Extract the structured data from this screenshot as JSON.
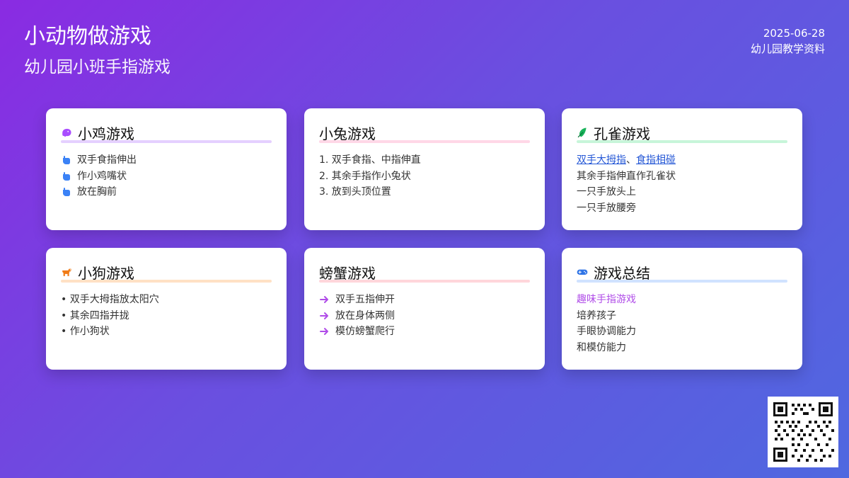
{
  "header": {
    "title": "小动物做游戏",
    "subtitle": "幼儿园小班手指游戏",
    "date": "2025-06-28",
    "source": "幼儿园教学资料"
  },
  "cards": [
    {
      "title": "小鸡游戏",
      "icon": "chick-icon",
      "accent": "#a94dff",
      "underline": "#d7b7ff",
      "items": [
        "双手食指伸出",
        "作小鸡嘴状",
        "放在胸前"
      ]
    },
    {
      "title": "小兔游戏",
      "icon": "",
      "accent": "#ff4d9f",
      "underline": "#ffc1da",
      "items": [
        "1. 双手食指、中指伸直",
        "2. 其余手指作小兔状",
        "3. 放到头顶位置"
      ]
    },
    {
      "title": "孔雀游戏",
      "icon": "feather-icon",
      "accent": "#19b35a",
      "underline": "#a9efc5",
      "items": {
        "link1": "双手大拇指",
        "sep": "、",
        "link2": "食指相碰",
        "line2": "其余手指伸直作孔雀状",
        "line3": "一只手放头上",
        "line4": "一只手放腰旁"
      }
    },
    {
      "title": "小狗游戏",
      "icon": "dog-icon",
      "accent": "#f07b16",
      "underline": "#ffd1a6",
      "items": [
        "• 双手大拇指放太阳穴",
        "• 其余四指并拢",
        "• 作小狗状"
      ]
    },
    {
      "title": "螃蟹游戏",
      "icon": "",
      "accent": "#b04de8",
      "underline": "#ffc0c8",
      "items": [
        "双手五指伸开",
        "放在身体两侧",
        "模仿螃蟹爬行"
      ]
    },
    {
      "title": "游戏总结",
      "icon": "gamepad-icon",
      "accent": "#2f74e6",
      "underline": "#b7d3ff",
      "summary": {
        "highlight": "趣味手指游戏",
        "line2": "培养孩子",
        "line3": "手眼协调能力",
        "line4": "和模仿能力"
      }
    }
  ],
  "qr": {
    "name": "qr-code"
  }
}
